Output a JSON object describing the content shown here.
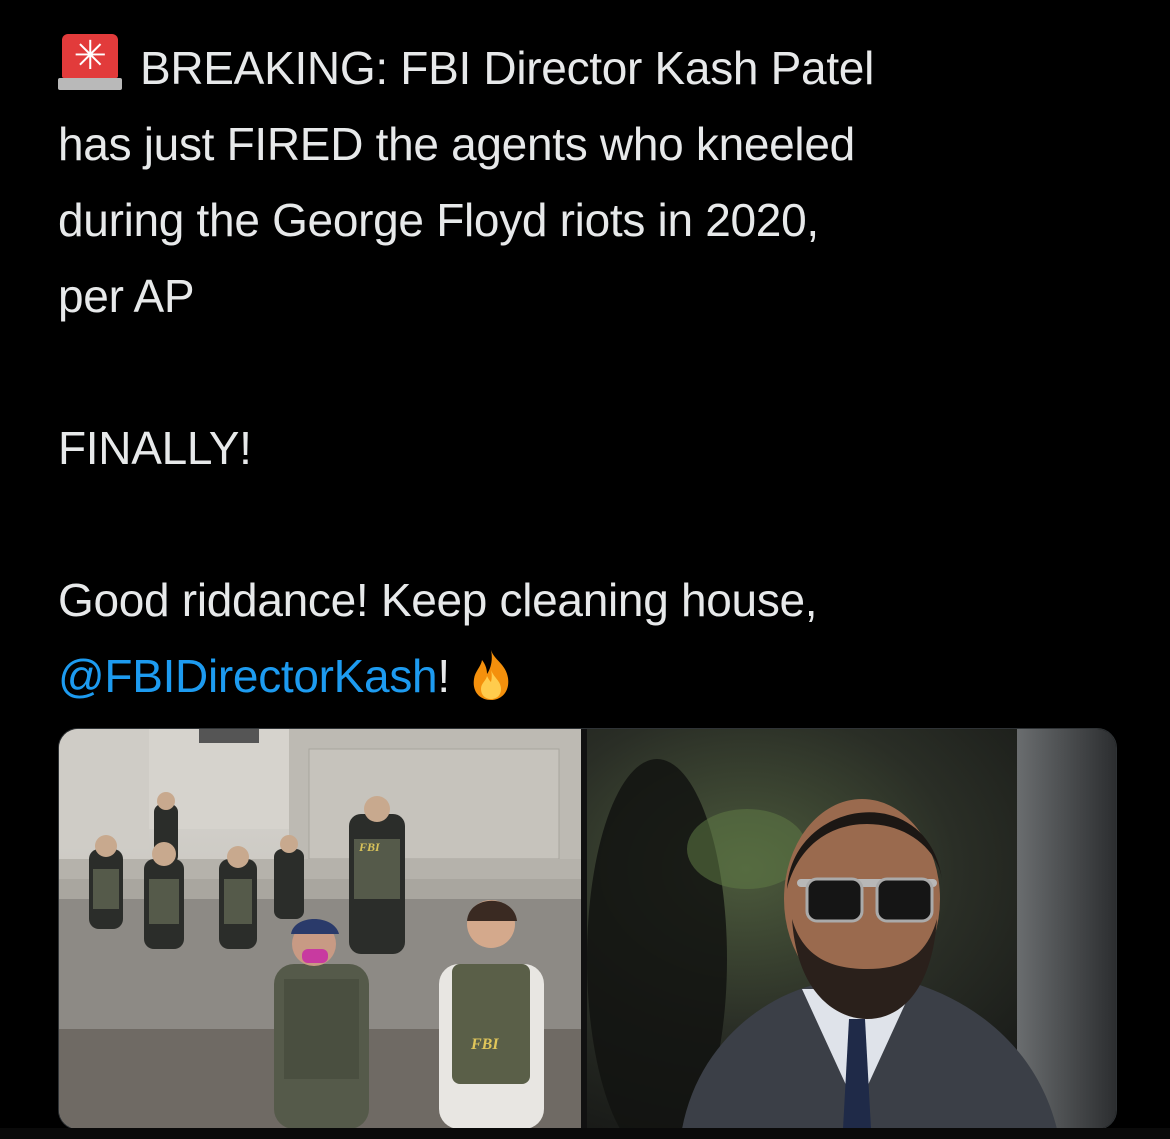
{
  "tweet": {
    "lines": [
      "BREAKING: FBI Director Kash Patel",
      "has just FIRED the agents who kneeled",
      "during the George Floyd riots in 2020,",
      "per AP",
      "FINALLY!",
      "Good riddance! Keep cleaning house,",
      "@FBIDirectorKash",
      "!"
    ],
    "leading_icon": "rotating-light-emoji",
    "trailing_icon": "fire-emoji",
    "mention_color": "#1d9bf0"
  },
  "media": {
    "left_photo": {
      "vest_text_1": "FBI",
      "vest_text_2": "FBI"
    }
  }
}
